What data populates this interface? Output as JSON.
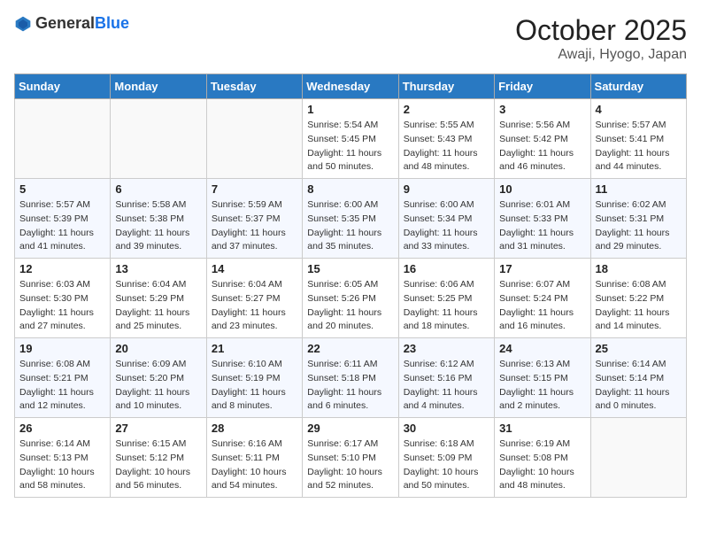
{
  "header": {
    "logo_general": "General",
    "logo_blue": "Blue",
    "month": "October 2025",
    "location": "Awaji, Hyogo, Japan"
  },
  "weekdays": [
    "Sunday",
    "Monday",
    "Tuesday",
    "Wednesday",
    "Thursday",
    "Friday",
    "Saturday"
  ],
  "weeks": [
    [
      {
        "day": "",
        "info": ""
      },
      {
        "day": "",
        "info": ""
      },
      {
        "day": "",
        "info": ""
      },
      {
        "day": "1",
        "info": "Sunrise: 5:54 AM\nSunset: 5:45 PM\nDaylight: 11 hours\nand 50 minutes."
      },
      {
        "day": "2",
        "info": "Sunrise: 5:55 AM\nSunset: 5:43 PM\nDaylight: 11 hours\nand 48 minutes."
      },
      {
        "day": "3",
        "info": "Sunrise: 5:56 AM\nSunset: 5:42 PM\nDaylight: 11 hours\nand 46 minutes."
      },
      {
        "day": "4",
        "info": "Sunrise: 5:57 AM\nSunset: 5:41 PM\nDaylight: 11 hours\nand 44 minutes."
      }
    ],
    [
      {
        "day": "5",
        "info": "Sunrise: 5:57 AM\nSunset: 5:39 PM\nDaylight: 11 hours\nand 41 minutes."
      },
      {
        "day": "6",
        "info": "Sunrise: 5:58 AM\nSunset: 5:38 PM\nDaylight: 11 hours\nand 39 minutes."
      },
      {
        "day": "7",
        "info": "Sunrise: 5:59 AM\nSunset: 5:37 PM\nDaylight: 11 hours\nand 37 minutes."
      },
      {
        "day": "8",
        "info": "Sunrise: 6:00 AM\nSunset: 5:35 PM\nDaylight: 11 hours\nand 35 minutes."
      },
      {
        "day": "9",
        "info": "Sunrise: 6:00 AM\nSunset: 5:34 PM\nDaylight: 11 hours\nand 33 minutes."
      },
      {
        "day": "10",
        "info": "Sunrise: 6:01 AM\nSunset: 5:33 PM\nDaylight: 11 hours\nand 31 minutes."
      },
      {
        "day": "11",
        "info": "Sunrise: 6:02 AM\nSunset: 5:31 PM\nDaylight: 11 hours\nand 29 minutes."
      }
    ],
    [
      {
        "day": "12",
        "info": "Sunrise: 6:03 AM\nSunset: 5:30 PM\nDaylight: 11 hours\nand 27 minutes."
      },
      {
        "day": "13",
        "info": "Sunrise: 6:04 AM\nSunset: 5:29 PM\nDaylight: 11 hours\nand 25 minutes."
      },
      {
        "day": "14",
        "info": "Sunrise: 6:04 AM\nSunset: 5:27 PM\nDaylight: 11 hours\nand 23 minutes."
      },
      {
        "day": "15",
        "info": "Sunrise: 6:05 AM\nSunset: 5:26 PM\nDaylight: 11 hours\nand 20 minutes."
      },
      {
        "day": "16",
        "info": "Sunrise: 6:06 AM\nSunset: 5:25 PM\nDaylight: 11 hours\nand 18 minutes."
      },
      {
        "day": "17",
        "info": "Sunrise: 6:07 AM\nSunset: 5:24 PM\nDaylight: 11 hours\nand 16 minutes."
      },
      {
        "day": "18",
        "info": "Sunrise: 6:08 AM\nSunset: 5:22 PM\nDaylight: 11 hours\nand 14 minutes."
      }
    ],
    [
      {
        "day": "19",
        "info": "Sunrise: 6:08 AM\nSunset: 5:21 PM\nDaylight: 11 hours\nand 12 minutes."
      },
      {
        "day": "20",
        "info": "Sunrise: 6:09 AM\nSunset: 5:20 PM\nDaylight: 11 hours\nand 10 minutes."
      },
      {
        "day": "21",
        "info": "Sunrise: 6:10 AM\nSunset: 5:19 PM\nDaylight: 11 hours\nand 8 minutes."
      },
      {
        "day": "22",
        "info": "Sunrise: 6:11 AM\nSunset: 5:18 PM\nDaylight: 11 hours\nand 6 minutes."
      },
      {
        "day": "23",
        "info": "Sunrise: 6:12 AM\nSunset: 5:16 PM\nDaylight: 11 hours\nand 4 minutes."
      },
      {
        "day": "24",
        "info": "Sunrise: 6:13 AM\nSunset: 5:15 PM\nDaylight: 11 hours\nand 2 minutes."
      },
      {
        "day": "25",
        "info": "Sunrise: 6:14 AM\nSunset: 5:14 PM\nDaylight: 11 hours\nand 0 minutes."
      }
    ],
    [
      {
        "day": "26",
        "info": "Sunrise: 6:14 AM\nSunset: 5:13 PM\nDaylight: 10 hours\nand 58 minutes."
      },
      {
        "day": "27",
        "info": "Sunrise: 6:15 AM\nSunset: 5:12 PM\nDaylight: 10 hours\nand 56 minutes."
      },
      {
        "day": "28",
        "info": "Sunrise: 6:16 AM\nSunset: 5:11 PM\nDaylight: 10 hours\nand 54 minutes."
      },
      {
        "day": "29",
        "info": "Sunrise: 6:17 AM\nSunset: 5:10 PM\nDaylight: 10 hours\nand 52 minutes."
      },
      {
        "day": "30",
        "info": "Sunrise: 6:18 AM\nSunset: 5:09 PM\nDaylight: 10 hours\nand 50 minutes."
      },
      {
        "day": "31",
        "info": "Sunrise: 6:19 AM\nSunset: 5:08 PM\nDaylight: 10 hours\nand 48 minutes."
      },
      {
        "day": "",
        "info": ""
      }
    ]
  ]
}
